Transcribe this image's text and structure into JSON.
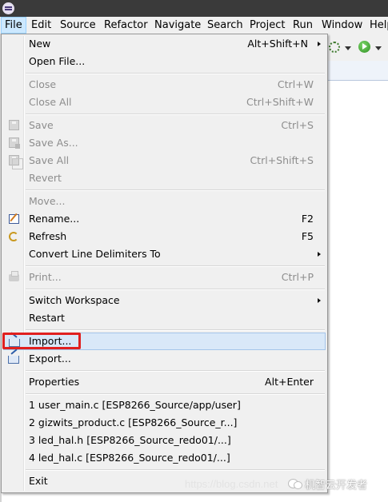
{
  "menubar": {
    "items": [
      "File",
      "Edit",
      "Source",
      "Refactor",
      "Navigate",
      "Search",
      "Project",
      "Run",
      "Window",
      "Help"
    ]
  },
  "menu": {
    "new": {
      "label": "New",
      "shortcut": "Alt+Shift+N"
    },
    "open_file": {
      "label": "Open File..."
    },
    "close": {
      "label": "Close",
      "shortcut": "Ctrl+W"
    },
    "close_all": {
      "label": "Close All",
      "shortcut": "Ctrl+Shift+W"
    },
    "save": {
      "label": "Save",
      "shortcut": "Ctrl+S"
    },
    "save_as": {
      "label": "Save As..."
    },
    "save_all": {
      "label": "Save All",
      "shortcut": "Ctrl+Shift+S"
    },
    "revert": {
      "label": "Revert"
    },
    "move": {
      "label": "Move..."
    },
    "rename": {
      "label": "Rename...",
      "shortcut": "F2"
    },
    "refresh": {
      "label": "Refresh",
      "shortcut": "F5"
    },
    "convert": {
      "label": "Convert Line Delimiters To"
    },
    "print": {
      "label": "Print...",
      "shortcut": "Ctrl+P"
    },
    "switch_workspace": {
      "label": "Switch Workspace"
    },
    "restart": {
      "label": "Restart"
    },
    "import": {
      "label": "Import..."
    },
    "export": {
      "label": "Export..."
    },
    "properties": {
      "label": "Properties",
      "shortcut": "Alt+Enter"
    },
    "recent": [
      "1 user_main.c  [ESP8266_Source/app/user]",
      "2 gizwits_product.c  [ESP8266_Source_r...]",
      "3 led_hal.h  [ESP8266_Source_redo01/...]",
      "4 led_hal.c  [ESP8266_Source_redo01/...]"
    ],
    "exit": {
      "label": "Exit"
    }
  },
  "watermark": {
    "url": "https://blog.csdn.net",
    "brand": "机智云开发者"
  },
  "colors": {
    "highlight": "#e0201f",
    "hover_bg": "#d9e8f8",
    "disabled_text": "#8d8d8d"
  }
}
